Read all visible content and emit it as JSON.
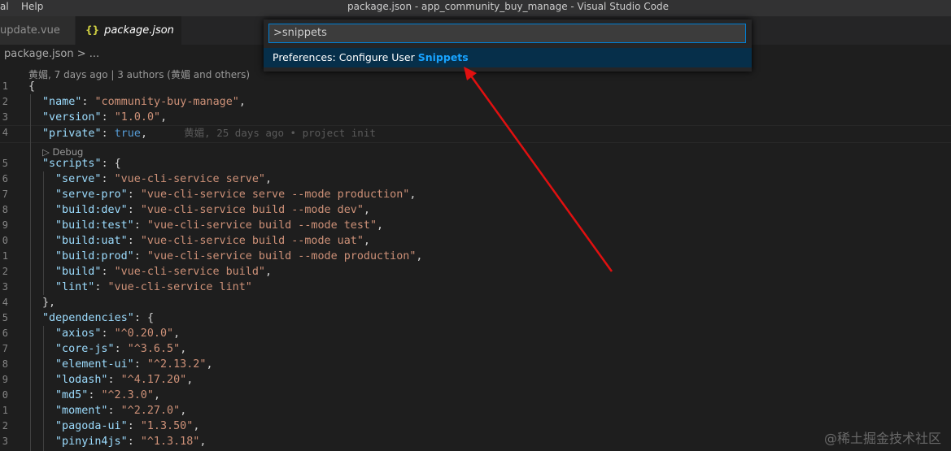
{
  "titlebar": {
    "menu": [
      "al",
      "Help"
    ],
    "window_title": "package.json - app_community_buy_manage - Visual Studio Code"
  },
  "tabs": [
    {
      "label": "update.vue",
      "active": false
    },
    {
      "label": "package.json",
      "active": true,
      "icon": "{}",
      "close": "✕"
    }
  ],
  "breadcrumb": "package.json > ...",
  "blame_header": "黄媚, 7 days ago | 3 authors (黄媚 and others)",
  "inline_blame": "黄媚, 25 days ago • project init",
  "codelens": "▷ Debug",
  "command_palette": {
    "input_value": ">snippets",
    "result_prefix": "Preferences: Configure User ",
    "result_highlight": "Snippets"
  },
  "line_numbers": [
    "1",
    "2",
    "3",
    "4",
    "5",
    "6",
    "7",
    "8",
    "9",
    "0",
    "1",
    "2",
    "3",
    "4",
    "5",
    "6",
    "7",
    "8",
    "9",
    "0",
    "1",
    "2",
    "3"
  ],
  "code": [
    [
      {
        "t": "p",
        "v": "{"
      }
    ],
    [
      {
        "t": "k",
        "v": "\"name\""
      },
      {
        "t": "p",
        "v": ": "
      },
      {
        "t": "s",
        "v": "\"community-buy-manage\""
      },
      {
        "t": "p",
        "v": ","
      }
    ],
    [
      {
        "t": "k",
        "v": "\"version\""
      },
      {
        "t": "p",
        "v": ": "
      },
      {
        "t": "s",
        "v": "\"1.0.0\""
      },
      {
        "t": "p",
        "v": ","
      }
    ],
    [
      {
        "t": "k",
        "v": "\"private\""
      },
      {
        "t": "p",
        "v": ": "
      },
      {
        "t": "b",
        "v": "true"
      },
      {
        "t": "p",
        "v": ","
      }
    ],
    [
      {
        "t": "k",
        "v": "\"scripts\""
      },
      {
        "t": "p",
        "v": ": {"
      }
    ],
    [
      {
        "t": "k",
        "v": "\"serve\""
      },
      {
        "t": "p",
        "v": ": "
      },
      {
        "t": "s",
        "v": "\"vue-cli-service serve\""
      },
      {
        "t": "p",
        "v": ","
      }
    ],
    [
      {
        "t": "k",
        "v": "\"serve-pro\""
      },
      {
        "t": "p",
        "v": ": "
      },
      {
        "t": "s",
        "v": "\"vue-cli-service serve --mode production\""
      },
      {
        "t": "p",
        "v": ","
      }
    ],
    [
      {
        "t": "k",
        "v": "\"build:dev\""
      },
      {
        "t": "p",
        "v": ": "
      },
      {
        "t": "s",
        "v": "\"vue-cli-service build --mode dev\""
      },
      {
        "t": "p",
        "v": ","
      }
    ],
    [
      {
        "t": "k",
        "v": "\"build:test\""
      },
      {
        "t": "p",
        "v": ": "
      },
      {
        "t": "s",
        "v": "\"vue-cli-service build --mode test\""
      },
      {
        "t": "p",
        "v": ","
      }
    ],
    [
      {
        "t": "k",
        "v": "\"build:uat\""
      },
      {
        "t": "p",
        "v": ": "
      },
      {
        "t": "s",
        "v": "\"vue-cli-service build --mode uat\""
      },
      {
        "t": "p",
        "v": ","
      }
    ],
    [
      {
        "t": "k",
        "v": "\"build:prod\""
      },
      {
        "t": "p",
        "v": ": "
      },
      {
        "t": "s",
        "v": "\"vue-cli-service build --mode production\""
      },
      {
        "t": "p",
        "v": ","
      }
    ],
    [
      {
        "t": "k",
        "v": "\"build\""
      },
      {
        "t": "p",
        "v": ": "
      },
      {
        "t": "s",
        "v": "\"vue-cli-service build\""
      },
      {
        "t": "p",
        "v": ","
      }
    ],
    [
      {
        "t": "k",
        "v": "\"lint\""
      },
      {
        "t": "p",
        "v": ": "
      },
      {
        "t": "s",
        "v": "\"vue-cli-service lint\""
      }
    ],
    [
      {
        "t": "p",
        "v": "},"
      }
    ],
    [
      {
        "t": "k",
        "v": "\"dependencies\""
      },
      {
        "t": "p",
        "v": ": {"
      }
    ],
    [
      {
        "t": "k",
        "v": "\"axios\""
      },
      {
        "t": "p",
        "v": ": "
      },
      {
        "t": "s",
        "v": "\"^0.20.0\""
      },
      {
        "t": "p",
        "v": ","
      }
    ],
    [
      {
        "t": "k",
        "v": "\"core-js\""
      },
      {
        "t": "p",
        "v": ": "
      },
      {
        "t": "s",
        "v": "\"^3.6.5\""
      },
      {
        "t": "p",
        "v": ","
      }
    ],
    [
      {
        "t": "k",
        "v": "\"element-ui\""
      },
      {
        "t": "p",
        "v": ": "
      },
      {
        "t": "s",
        "v": "\"^2.13.2\""
      },
      {
        "t": "p",
        "v": ","
      }
    ],
    [
      {
        "t": "k",
        "v": "\"lodash\""
      },
      {
        "t": "p",
        "v": ": "
      },
      {
        "t": "s",
        "v": "\"^4.17.20\""
      },
      {
        "t": "p",
        "v": ","
      }
    ],
    [
      {
        "t": "k",
        "v": "\"md5\""
      },
      {
        "t": "p",
        "v": ": "
      },
      {
        "t": "s",
        "v": "\"^2.3.0\""
      },
      {
        "t": "p",
        "v": ","
      }
    ],
    [
      {
        "t": "k",
        "v": "\"moment\""
      },
      {
        "t": "p",
        "v": ": "
      },
      {
        "t": "s",
        "v": "\"^2.27.0\""
      },
      {
        "t": "p",
        "v": ","
      }
    ],
    [
      {
        "t": "k",
        "v": "\"pagoda-ui\""
      },
      {
        "t": "p",
        "v": ": "
      },
      {
        "t": "s",
        "v": "\"1.3.50\""
      },
      {
        "t": "p",
        "v": ","
      }
    ],
    [
      {
        "t": "k",
        "v": "\"pinyin4js\""
      },
      {
        "t": "p",
        "v": ": "
      },
      {
        "t": "s",
        "v": "\"^1.3.18\""
      },
      {
        "t": "p",
        "v": ","
      }
    ]
  ],
  "watermark": "@稀土掘金技术社区",
  "colors": {
    "key": "#9cdcfe",
    "string": "#ce9178",
    "keyword": "#569cd6",
    "highlight": "#18a3ff",
    "arrow": "#e01010"
  }
}
